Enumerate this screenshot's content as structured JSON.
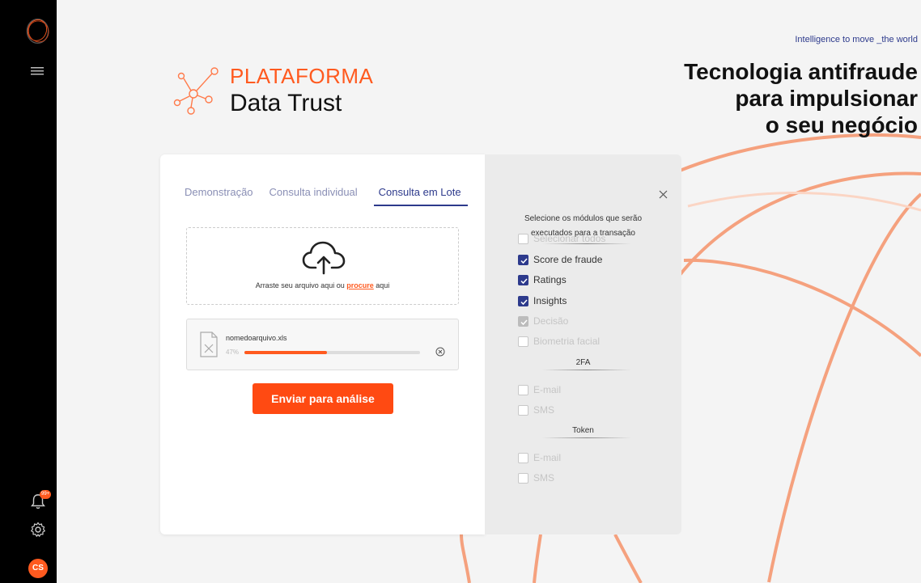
{
  "sidebar": {
    "badge": "99+",
    "avatar_initials": "CS"
  },
  "header": {
    "tagline": "Intelligence to move _the world",
    "hero_line1": "Tecnologia antifraude",
    "hero_line2": "para impulsionar",
    "hero_line3": "o seu negócio"
  },
  "brand": {
    "line1": "PLATAFORMA",
    "line2": "Data Trust"
  },
  "tabs": [
    {
      "label": "Demonstração",
      "active": false
    },
    {
      "label": "Consulta individual",
      "active": false
    },
    {
      "label": "Consulta em Lote",
      "active": true
    }
  ],
  "upload": {
    "prompt_before": "Arraste seu arquivo aqui ou ",
    "prompt_link": "procure",
    "prompt_after": " aqui"
  },
  "file": {
    "name": "nomedoarquivo.xls",
    "progress_label": "47%",
    "progress": 0.47
  },
  "submit_label": "Enviar para análise",
  "modules": {
    "title_line1": "Selecione os módulos que serão",
    "title_line2": "executados para a transação",
    "select_all": "Selecionar todos",
    "items": [
      {
        "label": "Score de fraude",
        "state": "checked"
      },
      {
        "label": "Ratings",
        "state": "checked"
      },
      {
        "label": "Insights",
        "state": "checked"
      },
      {
        "label": "Decisão",
        "state": "checked-disabled"
      },
      {
        "label": "Biometria facial",
        "state": "disabled"
      }
    ],
    "section_2fa": "2FA",
    "items_2fa": [
      {
        "label": "E-mail",
        "state": "disabled"
      },
      {
        "label": "SMS",
        "state": "disabled"
      }
    ],
    "section_token": "Token",
    "items_token": [
      {
        "label": "E-mail",
        "state": "disabled"
      },
      {
        "label": "SMS",
        "state": "disabled"
      }
    ]
  },
  "colors": {
    "accent": "#ff5a1f",
    "primary": "#2d3a8c",
    "sidebar": "#000000"
  }
}
